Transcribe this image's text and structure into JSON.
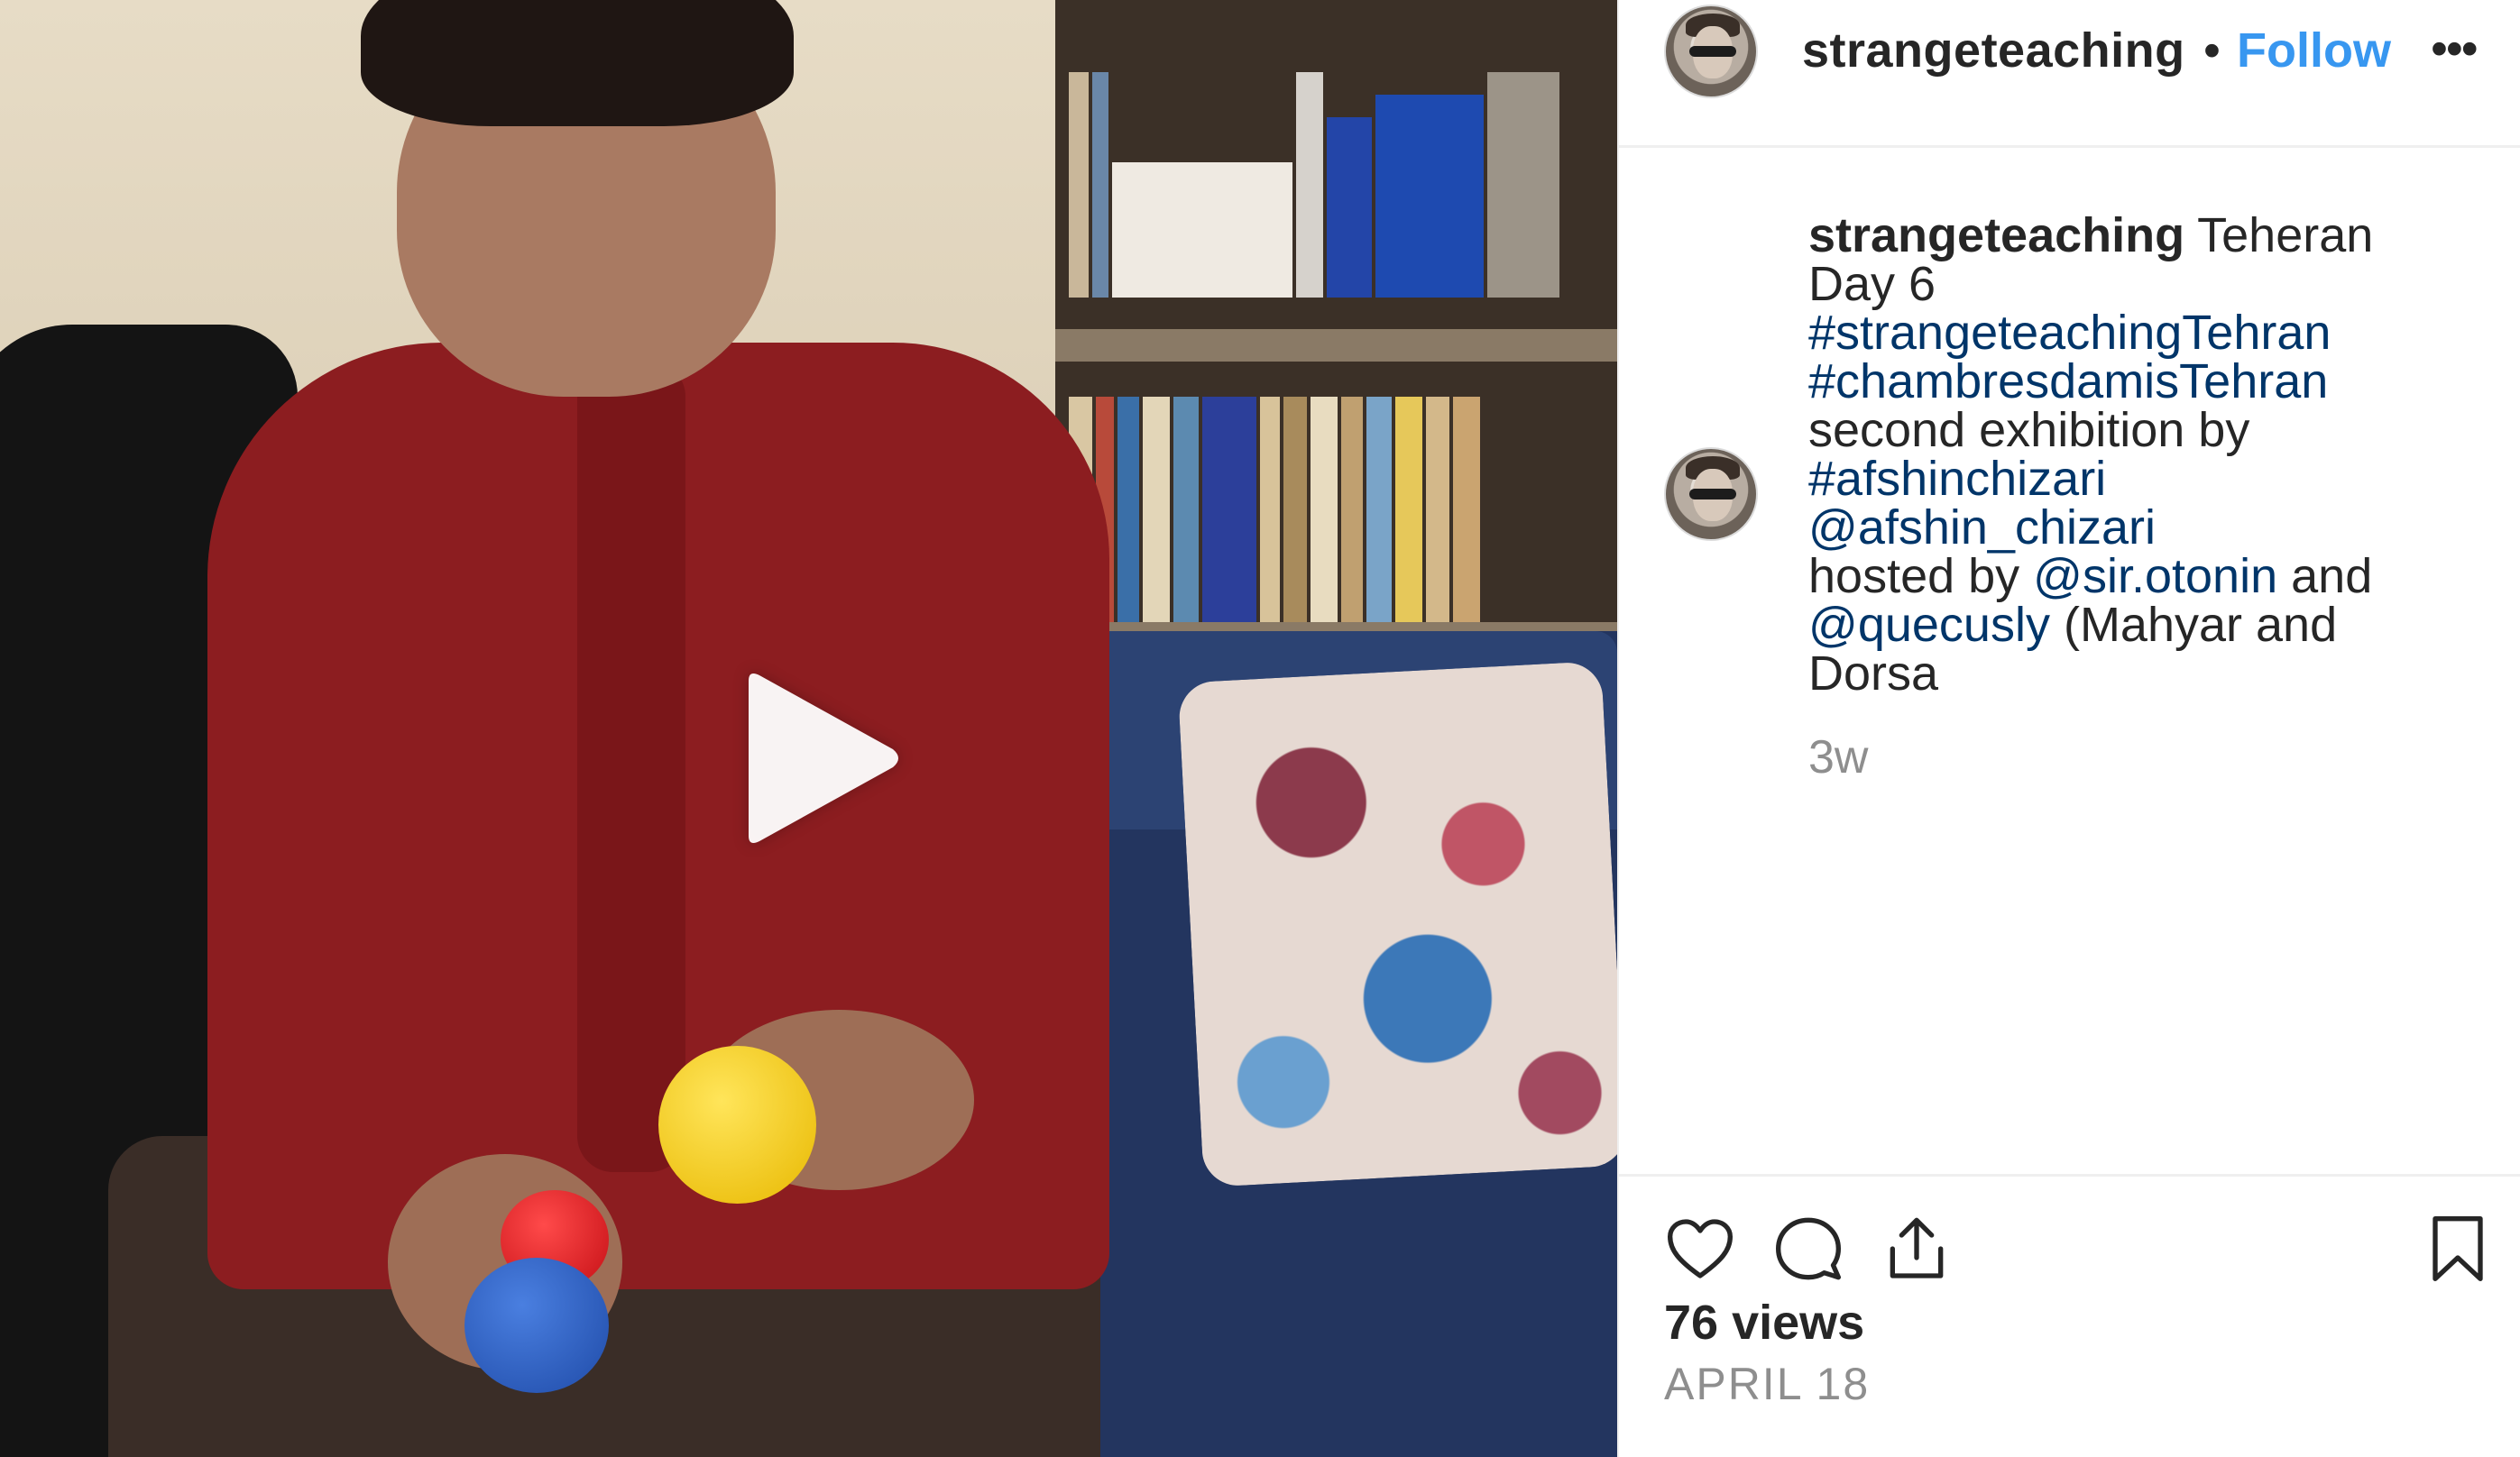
{
  "post": {
    "username": "strangeteaching",
    "follow_label": "Follow",
    "separator": "•",
    "more_label": "•••"
  },
  "caption": {
    "username": "strangeteaching",
    "line1_text": " Teheran",
    "line2_text": "Day 6",
    "hashtag1": "#strangeteachingTehran",
    "hashtag2": "#chambresdamisTehran",
    "line5_text": "second exhibition by",
    "hashtag3": "#afshinchizari",
    "mention1": "@afshin_chizari",
    "hosted_prefix": "hosted by ",
    "mention2": "@sir.otonin",
    "and_text": " and",
    "mention3": "@quecusly",
    "tail_text": " (Mahyar and",
    "last_line": "Dorsa",
    "age": "3w"
  },
  "stats": {
    "views": "76 views",
    "date": "APRIL 18"
  },
  "icons": {
    "play": "play-icon",
    "like": "heart-icon",
    "comment": "comment-icon",
    "share": "share-icon",
    "save": "bookmark-icon"
  },
  "colors": {
    "link": "#003569",
    "follow": "#3897f0",
    "muted": "#8e8e8e",
    "text": "#262626",
    "divider": "#efefef"
  }
}
